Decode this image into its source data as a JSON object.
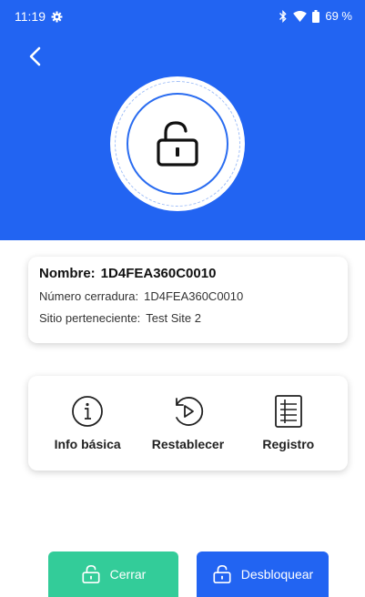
{
  "statusbar": {
    "time": "11:19",
    "battery": "69 %"
  },
  "lock": {
    "info": {
      "name_label": "Nombre:",
      "name_value": "1D4FEA360C0010",
      "number_label": "Número cerradura:",
      "number_value": "1D4FEA360C0010",
      "site_label": "Sitio perteneciente:",
      "site_value": "Test Site 2"
    }
  },
  "actions": {
    "info_label": "Info básica",
    "reset_label": "Restablecer",
    "log_label": "Registro"
  },
  "buttons": {
    "close_label": "Cerrar",
    "unlock_label": "Desbloquear"
  },
  "colors": {
    "header": "#2264f2",
    "close": "#33cc99",
    "unlock": "#2264f2"
  }
}
